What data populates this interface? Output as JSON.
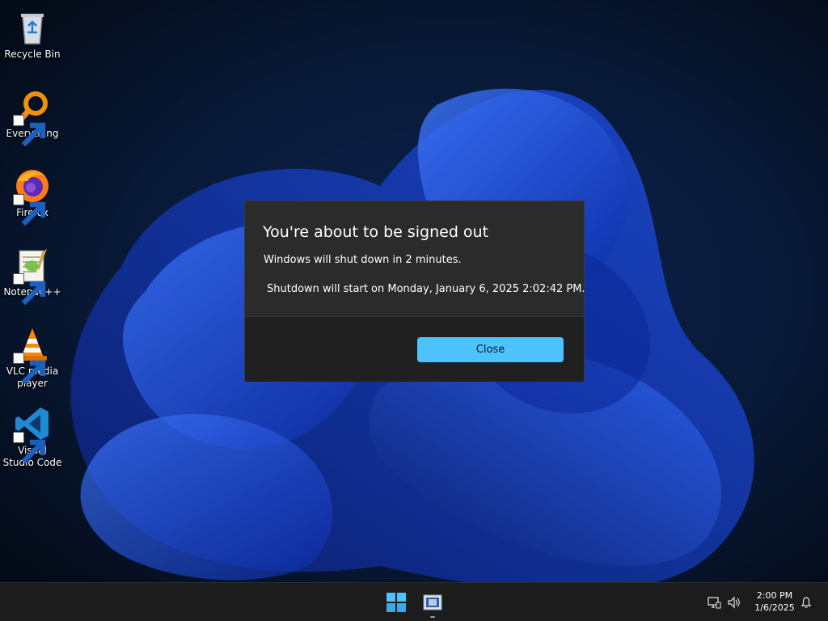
{
  "desktop": {
    "icons": [
      {
        "label": "Recycle Bin",
        "icon": "recycle-bin-icon"
      },
      {
        "label": "Everything",
        "icon": "everything-search-icon"
      },
      {
        "label": "Firefox",
        "icon": "firefox-icon"
      },
      {
        "label": "Notepad++",
        "icon": "notepad-plus-plus-icon"
      },
      {
        "label": "VLC media player",
        "icon": "vlc-icon"
      },
      {
        "label": "Visual Studio Code",
        "icon": "vscode-icon"
      }
    ]
  },
  "dialog": {
    "title": "You're about to be signed out",
    "message": "Windows will shut down in 2 minutes.",
    "detail": "Shutdown will start on Monday, January 6, 2025 2:02:42 PM.",
    "close_label": "Close",
    "accent_color": "#4cc2ff"
  },
  "taskbar": {
    "start_icon": "windows-start-icon",
    "pinned_app_icon": "app-window-icon",
    "tray": {
      "time": "2:00 PM",
      "date": "1/6/2025",
      "network_icon": "network-icon",
      "volume_icon": "volume-icon",
      "notification_icon": "bell-icon"
    }
  }
}
